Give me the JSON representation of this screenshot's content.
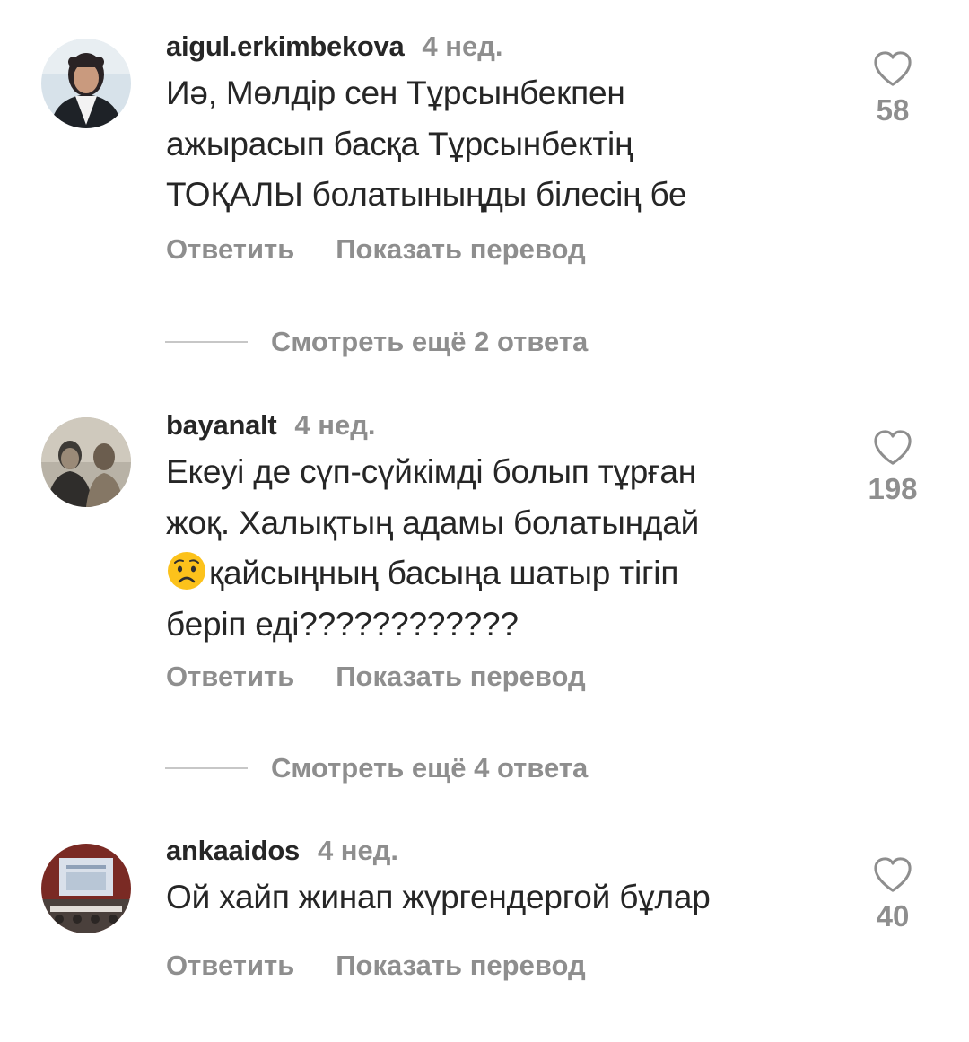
{
  "comments": [
    {
      "username": "aigul.erkimbekova",
      "time": "4 нед.",
      "lines": [
        "Иә, Мөлдір сен Тұрсынбекпен",
        "ажырасып басқа Тұрсынбектің",
        "ТОҚАЛЫ болатыныңды білесің бе"
      ],
      "likes": "58",
      "reply_label": "Ответить",
      "translate_label": "Показать перевод",
      "more_replies": "Смотреть ещё 2 ответа",
      "avatar_icon": "avatar-photo-woman"
    },
    {
      "username": "bayanalt",
      "time": "4 нед.",
      "lines": [
        "Екеуі де сүп-сүйкімді болып тұрған",
        "жоқ. Халықтың адамы болатындай",
        "қайсыңның басыңа шатыр тігіп",
        "беріп еді????????????"
      ],
      "emoji": "worried-face-icon",
      "likes": "198",
      "reply_label": "Ответить",
      "translate_label": "Показать перевод",
      "more_replies": "Смотреть ещё 4 ответа",
      "avatar_icon": "avatar-photo-couple"
    },
    {
      "username": "ankaaidos",
      "time": "4 нед.",
      "lines": [
        "Ой хайп жинап жүргендергой бұлар"
      ],
      "likes": "40",
      "reply_label": "Ответить",
      "translate_label": "Показать перевод",
      "avatar_icon": "avatar-photo-conference"
    }
  ],
  "icons": {
    "like": "heart-outline-icon"
  },
  "colors": {
    "text": "#262626",
    "secondary": "#8e8e8e",
    "divider": "#c7c7c7",
    "background": "#ffffff"
  }
}
